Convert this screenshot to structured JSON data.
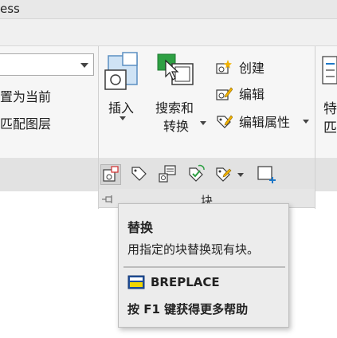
{
  "window": {
    "title_fragment": "ess"
  },
  "left_panel": {
    "dropdown_value": "",
    "set_current_label": "置为当前",
    "match_layer_label": "匹配图层"
  },
  "block_group": {
    "title": "块",
    "insert_label": "插入",
    "search_replace_label_line1": "搜索和",
    "search_replace_label_line2": "转换",
    "create_label": "创建",
    "edit_label": "编辑",
    "edit_attributes_label": "编辑属性"
  },
  "right_fragment": {
    "line1": "特",
    "line2": "匹"
  },
  "tooltip": {
    "title": "替换",
    "description": "用指定的块替换现有块。",
    "command": "BREPLACE",
    "help": "按 F1 键获得更多帮助"
  },
  "colors": {
    "accent_blue": "#1e78c8",
    "green_icon": "#2ea043",
    "yellow_spark": "#f2b200",
    "tooltip_bg": "#ececec"
  }
}
